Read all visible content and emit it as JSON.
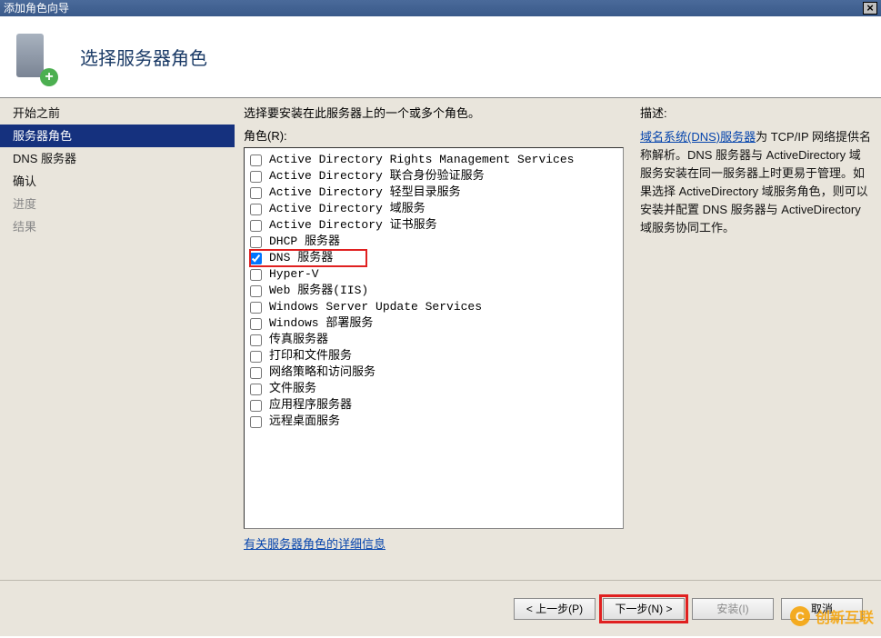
{
  "window": {
    "title": "添加角色向导"
  },
  "header": {
    "title": "选择服务器角色"
  },
  "sidebar": {
    "steps": [
      {
        "label": "开始之前",
        "disabled": false
      },
      {
        "label": "服务器角色",
        "selected": true
      },
      {
        "label": "DNS 服务器",
        "disabled": false
      },
      {
        "label": "确认",
        "disabled": false
      },
      {
        "label": "进度",
        "disabled": true
      },
      {
        "label": "结果",
        "disabled": true
      }
    ]
  },
  "main": {
    "instruction": "选择要安装在此服务器上的一个或多个角色。",
    "roles_label": "角色(R):",
    "roles": [
      {
        "label": "Active Directory Rights Management Services",
        "checked": false
      },
      {
        "label": "Active Directory 联合身份验证服务",
        "checked": false
      },
      {
        "label": "Active Directory 轻型目录服务",
        "checked": false
      },
      {
        "label": "Active Directory 域服务",
        "checked": false
      },
      {
        "label": "Active Directory 证书服务",
        "checked": false
      },
      {
        "label": "DHCP 服务器",
        "checked": false
      },
      {
        "label": "DNS 服务器",
        "checked": true,
        "highlight": true
      },
      {
        "label": "Hyper-V",
        "checked": false
      },
      {
        "label": "Web 服务器(IIS)",
        "checked": false
      },
      {
        "label": "Windows Server Update Services",
        "checked": false
      },
      {
        "label": "Windows 部署服务",
        "checked": false
      },
      {
        "label": "传真服务器",
        "checked": false
      },
      {
        "label": "打印和文件服务",
        "checked": false
      },
      {
        "label": "网络策略和访问服务",
        "checked": false
      },
      {
        "label": "文件服务",
        "checked": false
      },
      {
        "label": "应用程序服务器",
        "checked": false
      },
      {
        "label": "远程桌面服务",
        "checked": false
      }
    ],
    "more_link": "有关服务器角色的详细信息",
    "desc_label": "描述:",
    "desc_link": "域名系统(DNS)服务器",
    "desc_rest": "为 TCP/IP 网络提供名称解析。DNS 服务器与 ActiveDirectory 域服务安装在同一服务器上时更易于管理。如果选择 ActiveDirectory 域服务角色，则可以安装并配置 DNS 服务器与 ActiveDirectory 域服务协同工作。"
  },
  "footer": {
    "prev": "< 上一步(P)",
    "next": "下一步(N) >",
    "install": "安装(I)",
    "cancel": "取消"
  },
  "watermark": {
    "text": "创新互联"
  }
}
